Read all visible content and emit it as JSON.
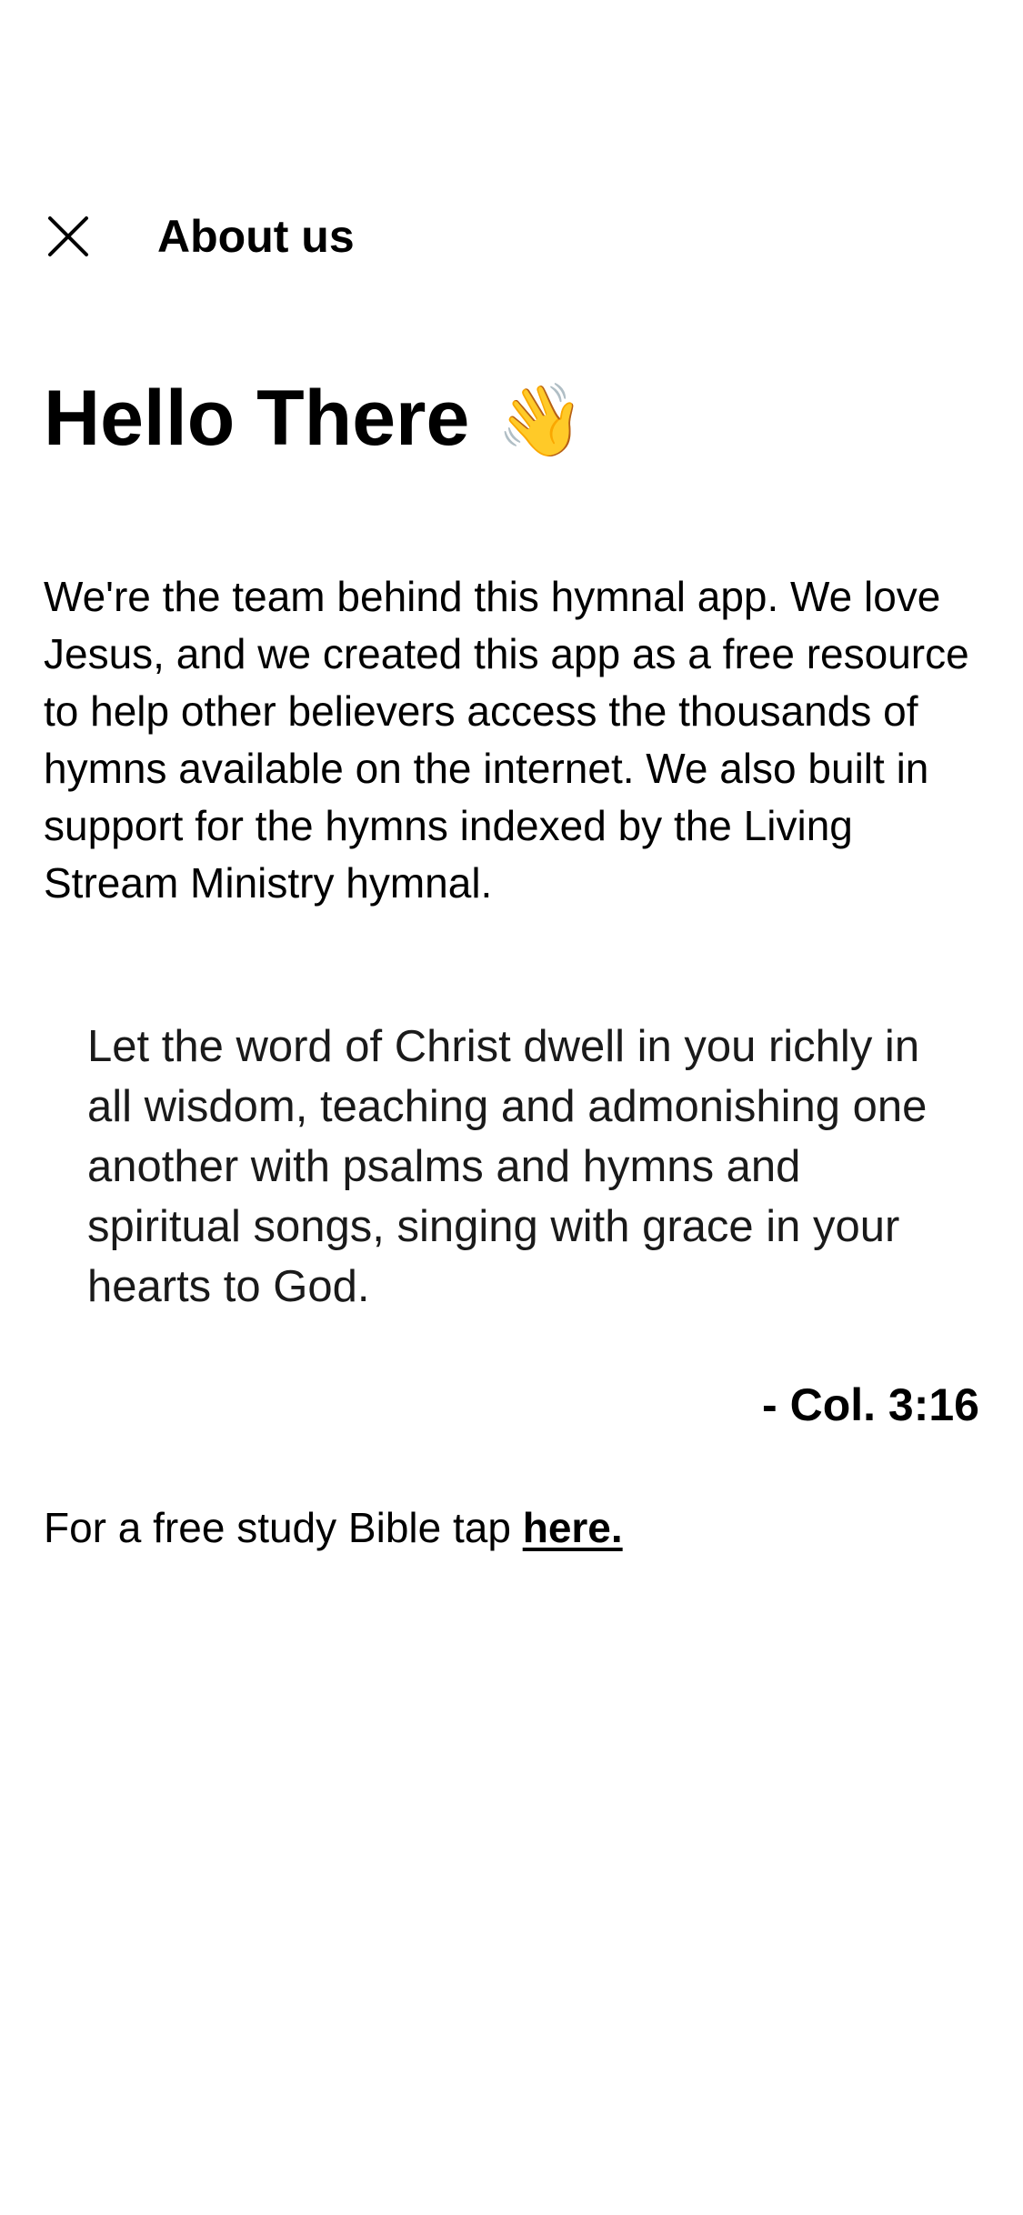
{
  "header": {
    "close_icon": "close-icon",
    "title": "About us"
  },
  "hero": {
    "title": "Hello There",
    "emoji": "👋"
  },
  "intro": {
    "text": "We're the team behind this hymnal app. We love Jesus, and we created this app as a free resource to help other believers access the thousands of hymns available on the internet. We also built in support for the hymns indexed by the Living Stream Ministry hymnal."
  },
  "verse": {
    "text": "Let the word of Christ dwell in you richly in all wisdom, teaching and admonishing one another with psalms and hymns and spiritual songs, singing with grace in your hearts to God.",
    "reference": "- Col. 3:16"
  },
  "study_bible": {
    "prefix": "For a free study Bible tap ",
    "link_label": "here."
  }
}
